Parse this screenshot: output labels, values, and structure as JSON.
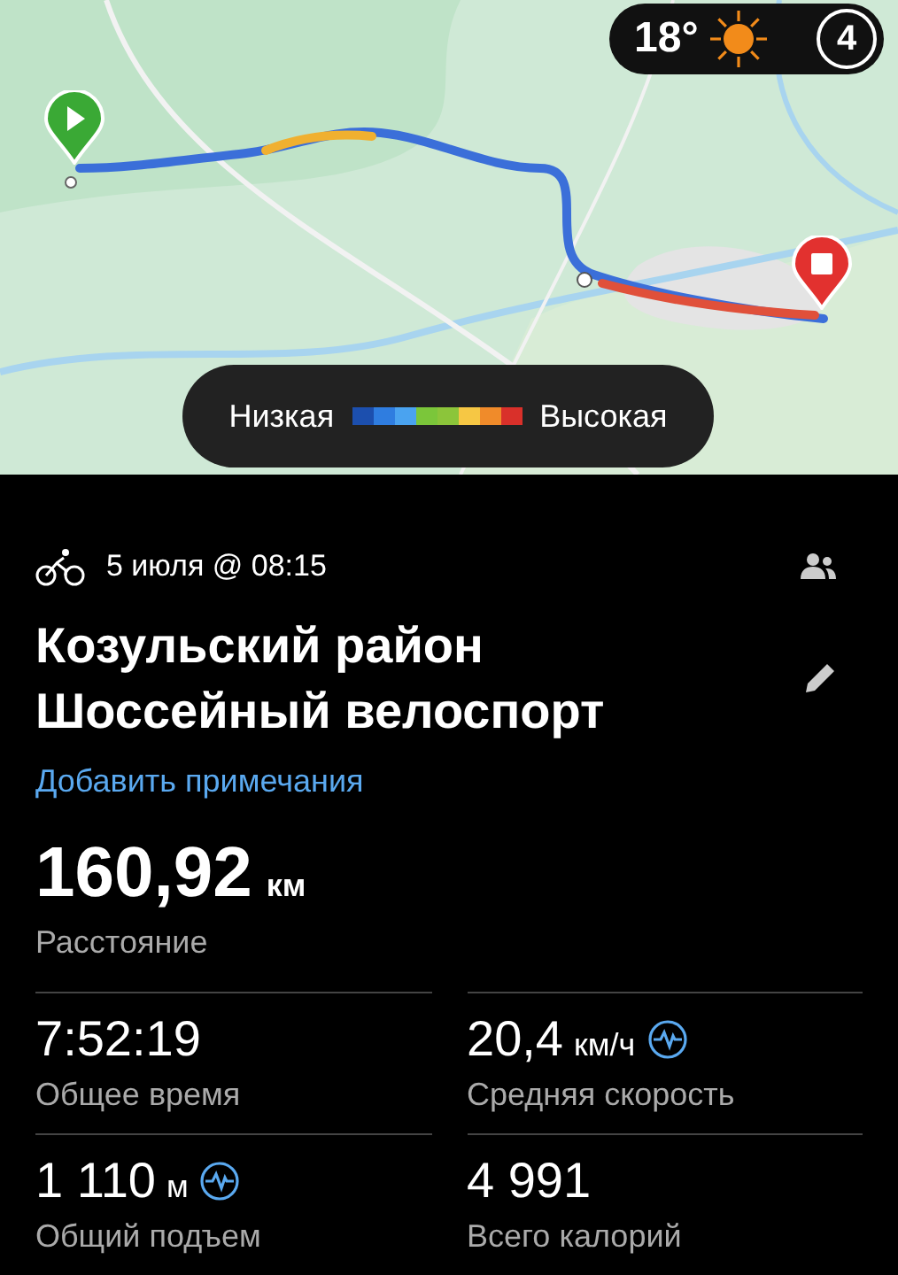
{
  "map": {
    "kind": "picture",
    "weather": {
      "temperature": "18°",
      "days": "4"
    },
    "legend": {
      "low": "Низкая",
      "high": "Высокая"
    }
  },
  "activity": {
    "date": "5 июля @ 08:15",
    "title_lines": [
      "Козульский район",
      "Шоссейный велоспорт"
    ],
    "add_notes": "Добавить примечания"
  },
  "distance": {
    "value": "160,92",
    "unit": "км",
    "label": "Расстояние"
  },
  "stats": [
    {
      "value": "7:52:19",
      "label": "Общее время",
      "chart_icon": false
    },
    {
      "value": "20,4",
      "unit": "км/ч",
      "label": "Средняя скорость",
      "chart_icon": true
    },
    {
      "value": "1 110",
      "unit": "м",
      "label": "Общий подъем",
      "chart_icon": true
    },
    {
      "value": "4 991",
      "label": "Всего калорий",
      "chart_icon": false
    }
  ]
}
